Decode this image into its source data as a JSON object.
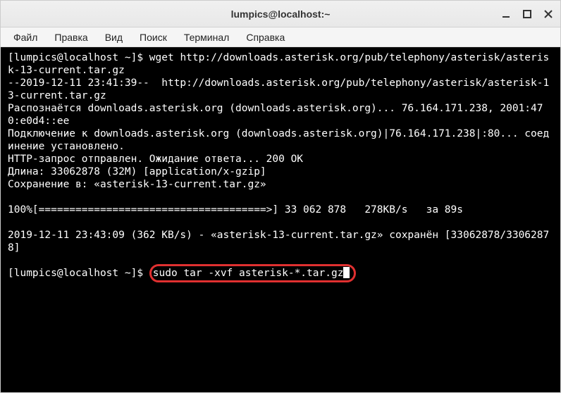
{
  "window": {
    "title": "lumpics@localhost:~"
  },
  "menu": {
    "file": "Файл",
    "edit": "Правка",
    "view": "Вид",
    "search": "Поиск",
    "terminal": "Терминал",
    "help": "Справка"
  },
  "terminal": {
    "line1_prompt": "[lumpics@localhost ~]$ ",
    "line1_cmd": "wget http://downloads.asterisk.org/pub/telephony/asterisk/asterisk-13-current.tar.gz",
    "line2": "--2019-12-11 23:41:39--  http://downloads.asterisk.org/pub/telephony/asterisk/asterisk-13-current.tar.gz",
    "line3": "Распознаётся downloads.asterisk.org (downloads.asterisk.org)... 76.164.171.238, 2001:470:e0d4::ee",
    "line4": "Подключение к downloads.asterisk.org (downloads.asterisk.org)|76.164.171.238|:80... соединение установлено.",
    "line5": "HTTP-запрос отправлен. Ожидание ответа... 200 OK",
    "line6": "Длина: 33062878 (32M) [application/x-gzip]",
    "line7": "Сохранение в: «asterisk-13-current.tar.gz»",
    "blank1": " ",
    "line8": "100%[=====================================>] 33 062 878   278KB/s   за 89s",
    "blank2": " ",
    "line9": "2019-12-11 23:43:09 (362 KB/s) - «asterisk-13-current.tar.gz» сохранён [33062878/33062878]",
    "blank3": " ",
    "line10_prompt": "[lumpics@localhost ~]$ ",
    "line10_cmd": "sudo tar -xvf asterisk-*.tar.gz"
  }
}
